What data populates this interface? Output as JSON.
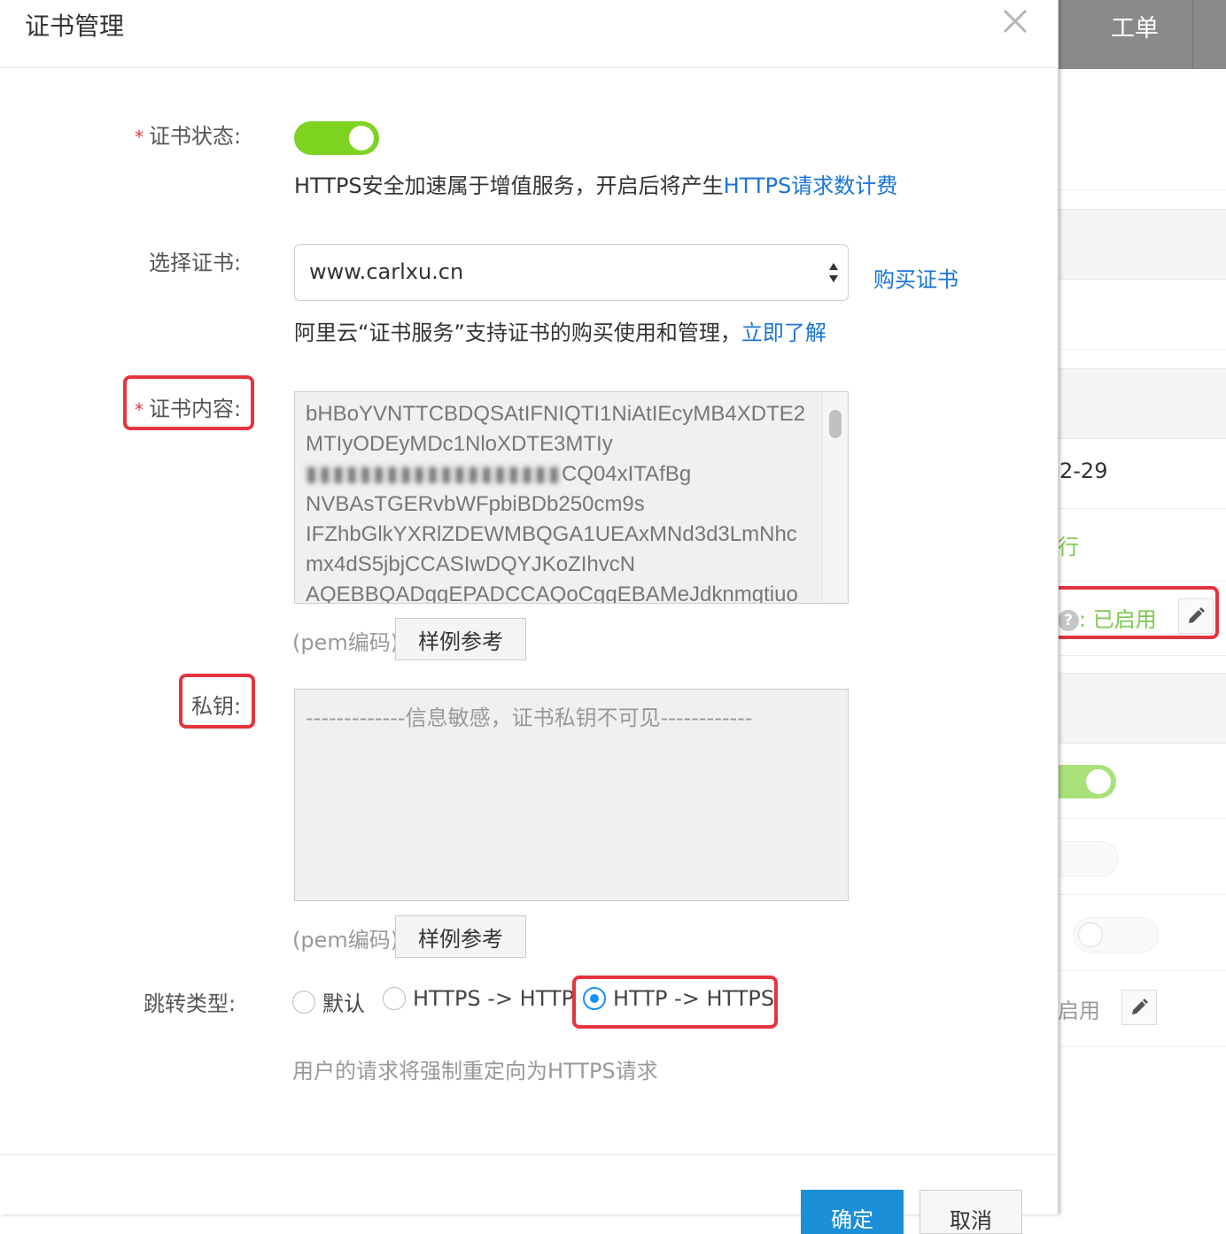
{
  "dialog": {
    "title": "证书管理"
  },
  "form": {
    "cert_status": {
      "label": "证书状态:",
      "required_mark": "*",
      "enabled": true,
      "desc_prefix": "HTTPS安全加速属于增值服务，开启后将产生",
      "desc_link": "HTTPS请求数计费"
    },
    "select_cert": {
      "label": "选择证书:",
      "value": "www.carlxu.cn",
      "buy_link": "购买证书",
      "desc_prefix": "阿里云“证书服务”支持证书的购买使用和管理，",
      "desc_link": "立即了解"
    },
    "cert_content": {
      "label": "证书内容:",
      "required_mark": "*",
      "lines": [
        "bHBoYVNTTCBDQSAtIFNIQTI1NiAtIEcyMB4XDTE2",
        "MTIyODEyMDc1NloXDTE3MTIy",
        "▮▮▮▮▮▮▮▮▮▮▮▮▮▮▮▮▮▮▮",
        "CQ04xITAfBg",
        "NVBAsTGERvbWFpbiBDb250cm9s",
        "IFZhbGlkYXRlZDEWMBQGA1UEAxMNd3d3LmNhc",
        "mx4dS5jbjCCASIwDQYJKoZIhvcN",
        "AQEBBQADggEPADCCAQoCggEBAMeJdknmgtiuo"
      ],
      "pem_note": "(pem编码)",
      "sample_button": "样例参考"
    },
    "private_key": {
      "label": "私钥:",
      "placeholder": "-------------信息敏感，证书私钥不可见------------",
      "pem_note": "(pem编码)",
      "sample_button": "样例参考"
    },
    "redirect_type": {
      "label": "跳转类型:",
      "options": [
        "默认",
        "HTTPS -> HTTP",
        "HTTP -> HTTPS"
      ],
      "selected": "HTTP -> HTTPS",
      "hint": "用户的请求将强制重定向为HTTPS请求"
    }
  },
  "footer": {
    "ok": "确定",
    "cancel": "取消"
  },
  "background": {
    "header_tab": "工单",
    "date_fragment": "2-29",
    "status_fragment": "行",
    "cert_status_prefix": "?",
    "cert_status_value": ": 已启用",
    "enabled_fragment": "启用"
  },
  "colors": {
    "accent": "#1a74d8",
    "switch_on": "#7ed321",
    "highlight": "#e5343d",
    "primary_button": "#1b8fd8"
  },
  "icons": [
    "close-icon",
    "select-arrows-icon",
    "edit-icon",
    "help-icon"
  ]
}
